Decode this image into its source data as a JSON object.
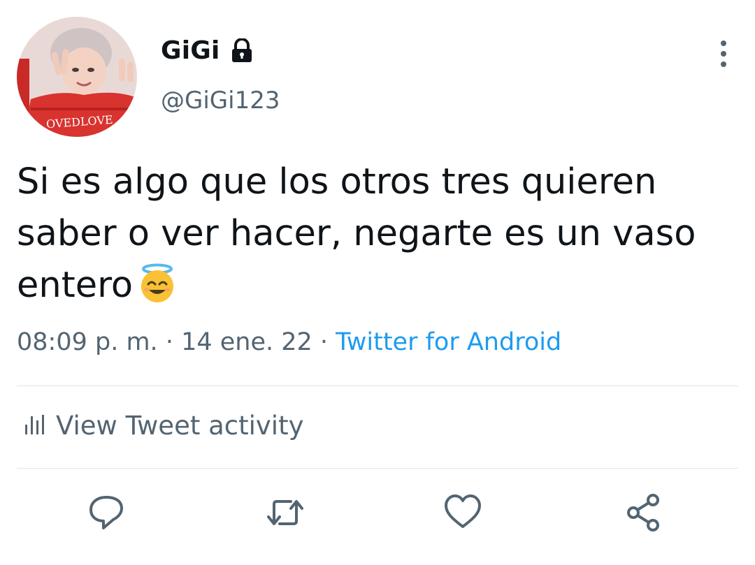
{
  "user": {
    "display_name": "GiGi",
    "handle": "@GiGi123",
    "avatar_shirt_text": "OVEDLOVE",
    "protected_icon": "lock-icon"
  },
  "tweet": {
    "text": "Si es algo que los otros tres quieren saber o ver hacer, negarte es un vaso entero",
    "emoji": "smiling-face-with-halo",
    "time": "08:09 p. m.",
    "separator": " · ",
    "date": "14 ene. 22",
    "source": "Twitter for Android"
  },
  "activity": {
    "label": "View Tweet activity",
    "icon": "bar-chart-icon"
  },
  "actions": [
    {
      "name": "reply",
      "icon": "comment-icon"
    },
    {
      "name": "retweet",
      "icon": "retweet-icon"
    },
    {
      "name": "like",
      "icon": "heart-icon"
    },
    {
      "name": "share",
      "icon": "share-icon"
    }
  ],
  "colors": {
    "text_primary": "#0f1419",
    "text_secondary": "#536471",
    "link": "#1d9bf0",
    "divider": "#dfe3e6"
  }
}
